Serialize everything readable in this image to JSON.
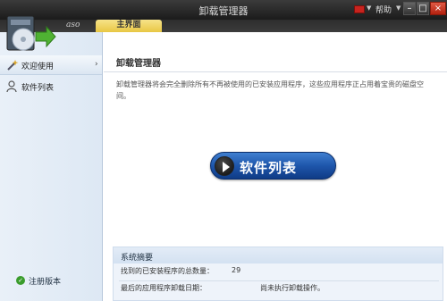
{
  "window": {
    "title": "卸载管理器",
    "help_label": "帮助",
    "minimize": "–",
    "maximize": "□",
    "close": "×"
  },
  "tabbar": {
    "brand": "aso",
    "tab_main": "主界面"
  },
  "sidebar": {
    "items": [
      {
        "label": "欢迎使用",
        "icon": "magic-wand-icon"
      },
      {
        "label": "软件列表",
        "icon": "user-list-icon"
      }
    ],
    "register_label": "注册版本"
  },
  "main": {
    "title": "卸载管理器",
    "description": "卸载管理器将会完全删除所有不再被使用的已安装应用程序，这些应用程序正占用着宝贵的磁盘空间。",
    "button_label": "软件列表"
  },
  "summary": {
    "title": "系统摘要",
    "rows": [
      {
        "key": "找到的已安装程序的总数量：",
        "value": "29"
      },
      {
        "key": "最后的应用程序卸载日期：",
        "value": "尚未执行卸载操作。"
      }
    ]
  },
  "colors": {
    "accent_tab": "#e8c744",
    "button_blue": "#1e56ab",
    "close_red": "#c8231e",
    "check_green": "#3a9c2c"
  }
}
